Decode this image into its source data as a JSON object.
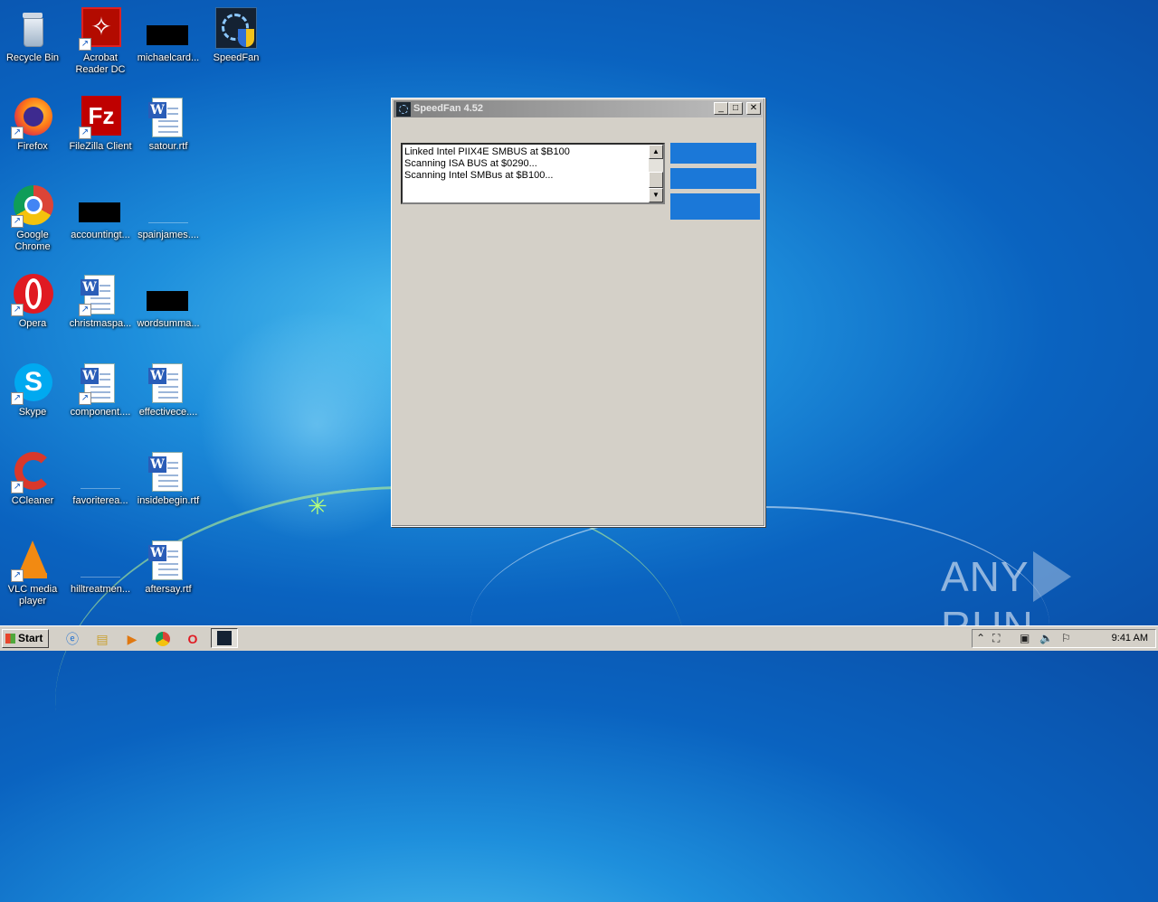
{
  "desktop": {
    "icons": [
      {
        "label": "Recycle Bin",
        "icon": "recycle-bin-icon"
      },
      {
        "label": "Acrobat\nReader DC",
        "icon": "acrobat-icon"
      },
      {
        "label": "michaelcard...",
        "icon": "black-thumbnail-icon"
      },
      {
        "label": "SpeedFan",
        "icon": "speedfan-icon"
      },
      {
        "label": "Firefox",
        "icon": "firefox-icon"
      },
      {
        "label": "FileZilla Client",
        "icon": "filezilla-icon"
      },
      {
        "label": "satour.rtf",
        "icon": "word-doc-icon"
      },
      {
        "label": "Google\nChrome",
        "icon": "chrome-icon"
      },
      {
        "label": "accountingt...",
        "icon": "black-thumbnail-icon"
      },
      {
        "label": "spainjames....",
        "icon": "blank-file-icon"
      },
      {
        "label": "Opera",
        "icon": "opera-icon"
      },
      {
        "label": "christmaspa...",
        "icon": "word-doc-icon"
      },
      {
        "label": "wordsumma...",
        "icon": "black-thumbnail-icon"
      },
      {
        "label": "Skype",
        "icon": "skype-icon"
      },
      {
        "label": "component....",
        "icon": "word-doc-icon"
      },
      {
        "label": "effectivece....",
        "icon": "word-doc-icon"
      },
      {
        "label": "CCleaner",
        "icon": "ccleaner-icon"
      },
      {
        "label": "favoriterea...",
        "icon": "blank-file-icon"
      },
      {
        "label": "insidebegin.rtf",
        "icon": "word-doc-icon"
      },
      {
        "label": "VLC media\nplayer",
        "icon": "vlc-icon"
      },
      {
        "label": "hilltreatmen...",
        "icon": "blank-file-icon"
      },
      {
        "label": "aftersay.rtf",
        "icon": "word-doc-icon"
      }
    ]
  },
  "window": {
    "title": "SpeedFan 4.52",
    "log_lines": [
      "Linked Intel PIIX4E SMBUS at $B100",
      "Scanning ISA BUS at $0290...",
      "Scanning Intel SMBus at $B100..."
    ]
  },
  "taskbar": {
    "start_label": "Start",
    "clock": "9:41 AM"
  },
  "watermark": {
    "left": "ANY",
    "right": "RUN"
  },
  "colors": {
    "accent_button": "#1b78d8",
    "window_bg": "#d4d0c8"
  }
}
